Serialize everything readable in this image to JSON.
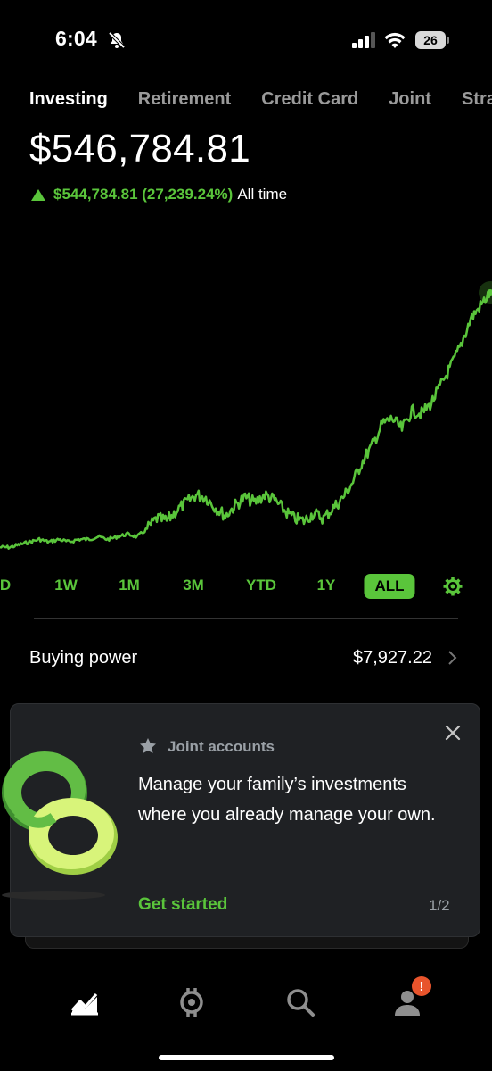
{
  "status_bar": {
    "time": "6:04",
    "battery": "26"
  },
  "tabs": [
    {
      "label": "Investing",
      "active": true
    },
    {
      "label": "Retirement",
      "active": false
    },
    {
      "label": "Credit Card",
      "active": false
    },
    {
      "label": "Joint",
      "active": false
    },
    {
      "label": "Stra",
      "active": false
    }
  ],
  "portfolio": {
    "value": "$546,784.81",
    "gain_amount": "$544,784.81 (27,239.24%)",
    "gain_period": "All time"
  },
  "chart_data": {
    "type": "line",
    "color": "#5ac53b",
    "values": [
      0.97,
      0.97,
      0.96,
      0.95,
      0.94,
      0.95,
      0.94,
      0.95,
      0.94,
      0.94,
      0.93,
      0.94,
      0.93,
      0.92,
      0.93,
      0.9,
      0.86,
      0.87,
      0.83,
      0.8,
      0.77,
      0.78,
      0.82,
      0.85,
      0.81,
      0.78,
      0.8,
      0.77,
      0.79,
      0.83,
      0.86,
      0.87,
      0.84,
      0.86,
      0.82,
      0.78,
      0.72,
      0.64,
      0.58,
      0.5,
      0.48,
      0.52,
      0.45,
      0.46,
      0.42,
      0.35,
      0.28,
      0.2,
      0.1,
      0.05,
      0.0
    ]
  },
  "ranges": [
    "D",
    "1W",
    "1M",
    "3M",
    "YTD",
    "1Y",
    "ALL"
  ],
  "selected_range": "ALL",
  "buying_power": {
    "label": "Buying power",
    "value": "$7,927.22"
  },
  "promo_card": {
    "kicker": "Joint accounts",
    "body": "Manage your family’s investments where you already manage your own.",
    "cta": "Get started",
    "pager": "1/2"
  },
  "bottom_nav": {
    "items": [
      "investing-icon",
      "crypto-icon",
      "search-icon",
      "account-icon"
    ],
    "badge": "!"
  },
  "colors": {
    "accent": "#5ac53b",
    "background": "#000000",
    "card": "#1f2124",
    "badge": "#e8542c"
  }
}
